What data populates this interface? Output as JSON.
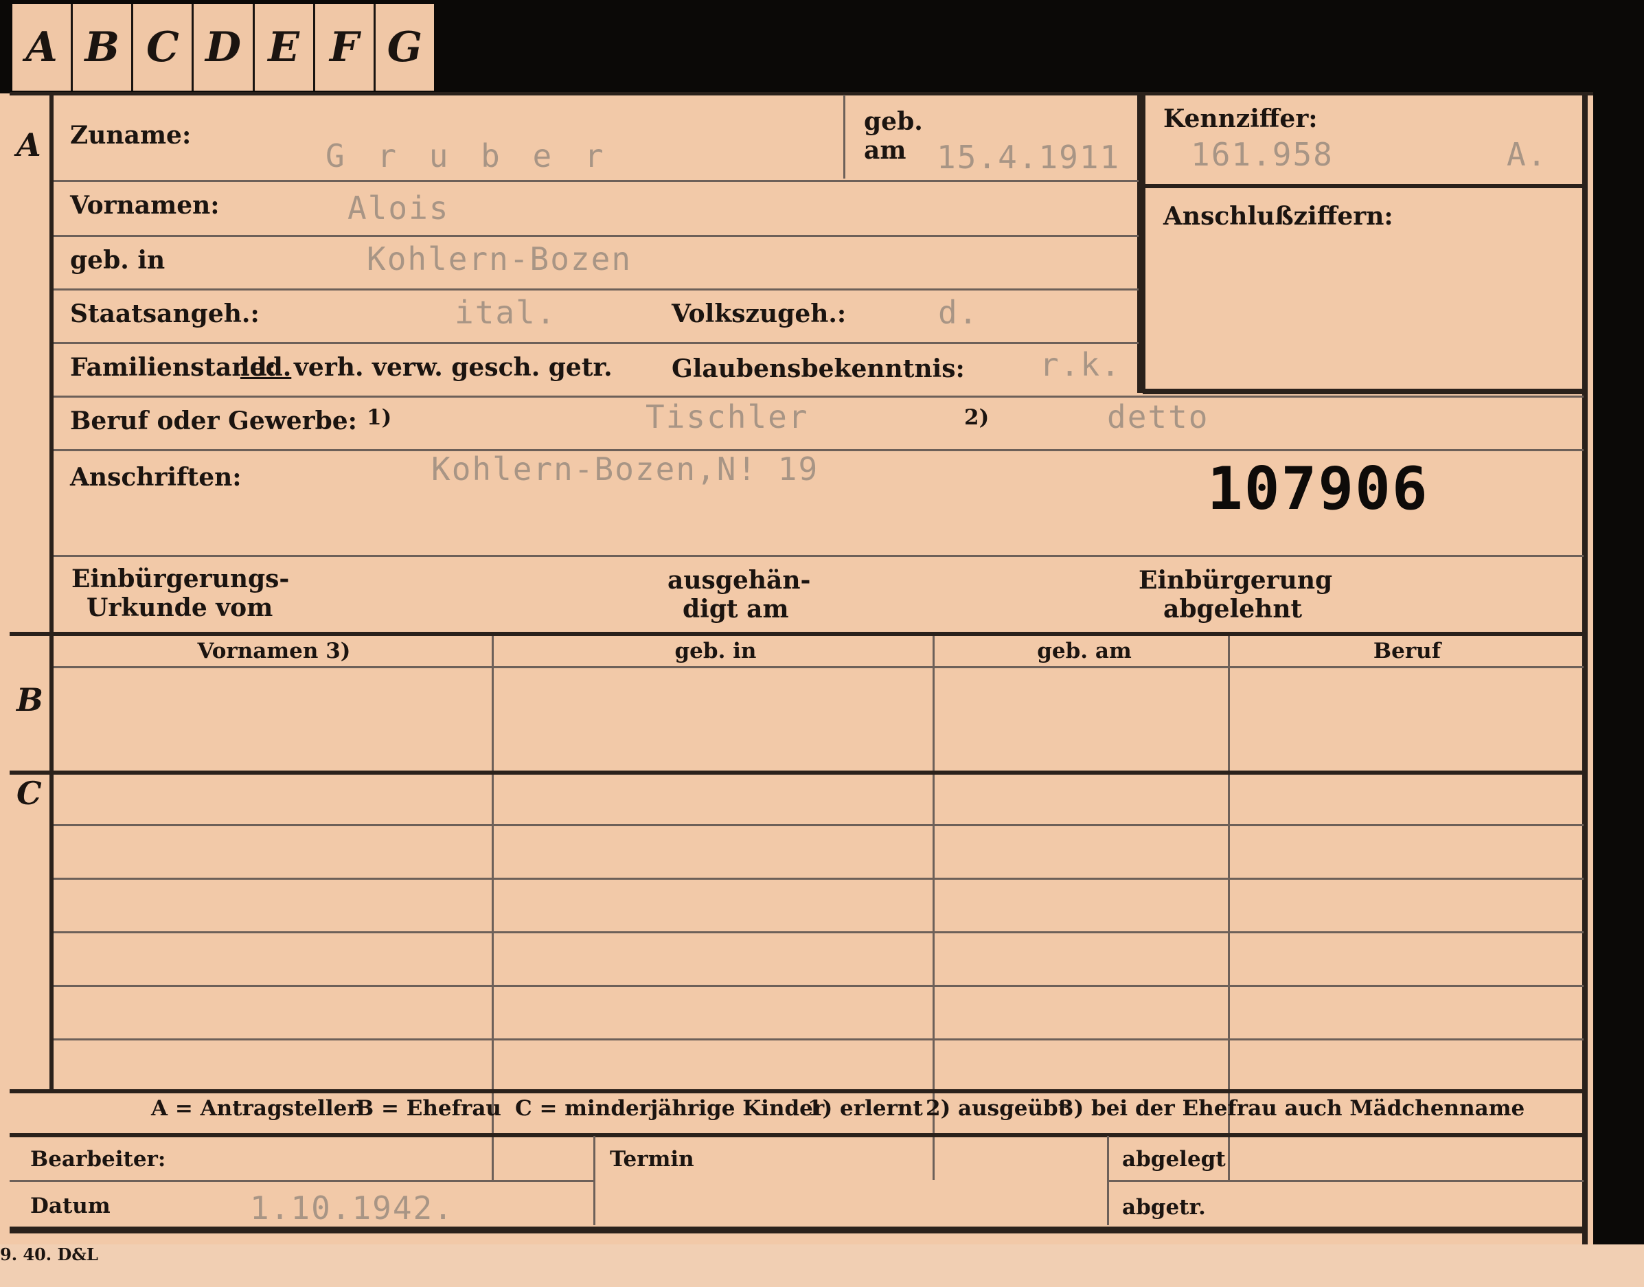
{
  "tabs": [
    "A",
    "B",
    "C",
    "D",
    "E",
    "F",
    "G"
  ],
  "sections": {
    "a": "A",
    "b": "B",
    "c": "C"
  },
  "labels": {
    "zuname": "Zuname:",
    "geb": "geb.",
    "am": "am",
    "kennziffer": "Kennziffer:",
    "anschlussziffern": "Anschlußziffern:",
    "vornamen": "Vornamen:",
    "geb_in": "geb. in",
    "staatsangeh": "Staatsangeh.:",
    "volkszugeh": "Volkszugeh.:",
    "familienstand": "Familienstand:",
    "familienstand_opt_led": "led.",
    "familienstand_opts": "verh. verw. gesch. getr.",
    "glaubensbekenntnis": "Glaubensbekenntnis:",
    "beruf": "Beruf oder Gewerbe:",
    "fn1": "1)",
    "fn2": "2)",
    "anschriften": "Anschriften:",
    "einbuergerung_urkunde_1": "Einbürgerungs-",
    "einbuergerung_urkunde_2": "Urkunde vom",
    "ausgehaendigt_1": "ausgehän-",
    "ausgehaendigt_2": "digt am",
    "einbuergerung_abgelehnt_1": "Einbürgerung",
    "einbuergerung_abgelehnt_2": "abgelehnt"
  },
  "values": {
    "zuname": "G r u b e r",
    "geb_am": "15.4.1911",
    "kennziffer": "161.958",
    "kennziffer_suffix": "A.",
    "vornamen": "Alois",
    "geb_in": "Kohlern-Bozen",
    "staatsangeh": "ital.",
    "volkszugeh": "d.",
    "glaubensbekenntnis": "r.k.",
    "beruf1": "Tischler",
    "beruf2": "detto",
    "anschrift": "Kohlern-Bozen,N! 19",
    "stamp_number": "107906"
  },
  "table": {
    "headers": [
      "Vornamen 3)",
      "geb. in",
      "geb. am",
      "Beruf"
    ]
  },
  "legend": {
    "a": "A = Antragsteller",
    "b": "B = Ehefrau",
    "c": "C = minderjährige Kinder",
    "f1": "1) erlernt",
    "f2": "2) ausgeübt",
    "f3": "3) bei der Ehefrau auch Mädchenname"
  },
  "footer": {
    "bearbeiter": "Bearbeiter:",
    "termin": "Termin",
    "abgelegt": "abgelegt",
    "datum": "Datum",
    "datum_value": "1.10.1942.",
    "abgetr": "abgetr.",
    "printer": "9. 40. D&L"
  }
}
